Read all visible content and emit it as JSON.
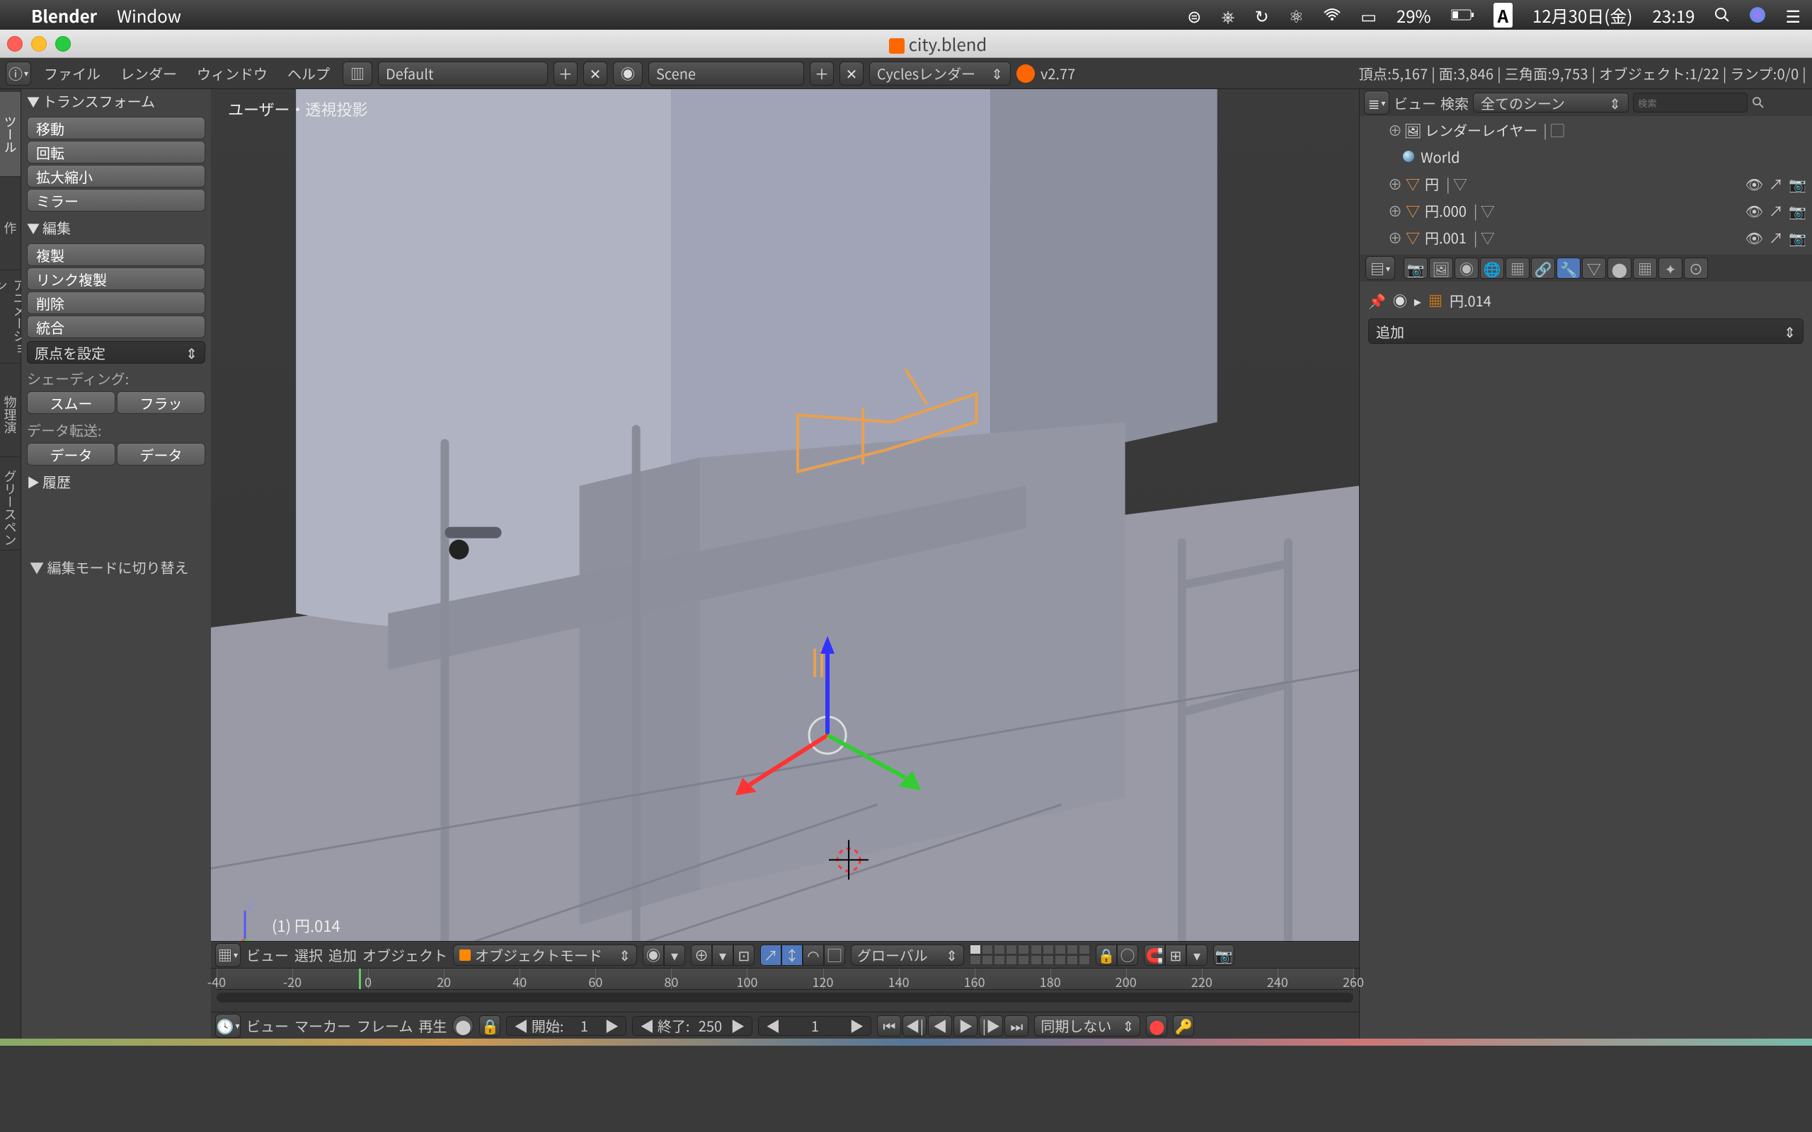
{
  "macos": {
    "app": "Blender",
    "menu_window": "Window",
    "battery": "29%",
    "input": "A",
    "date": "12月30日(金)",
    "time": "23:19"
  },
  "window": {
    "title": "city.blend"
  },
  "info": {
    "menus": {
      "file": "ファイル",
      "render": "レンダー",
      "window": "ウィンドウ",
      "help": "ヘルプ"
    },
    "layout": "Default",
    "scene": "Scene",
    "engine": "Cyclesレンダー",
    "version": "v2.77",
    "stats": "頂点:5,167 | 面:3,846 | 三角面:9,753 | オブジェクト:1/22 | ランプ:0/0 |"
  },
  "sidetabs": [
    "ツール",
    "作",
    "アニメーション",
    "物理演",
    "グリースペン"
  ],
  "toolshelf": {
    "transform_header": "トランスフォーム",
    "translate": "移動",
    "rotate": "回転",
    "scale": "拡大縮小",
    "mirror": "ミラー",
    "edit_header": "編集",
    "duplicate": "複製",
    "link_duplicate": "リンク複製",
    "delete": "削除",
    "join": "統合",
    "set_origin": "原点を設定",
    "shading_label": "シェーディング:",
    "smooth": "スムー",
    "flat": "フラッ",
    "data_transfer_label": "データ転送:",
    "data": "データ",
    "history_header": "履歴",
    "last_action": "編集モードに切り替え"
  },
  "viewport": {
    "projection": "ユーザー・透視投影",
    "active_object": "(1) 円.014"
  },
  "view_header": {
    "menus": {
      "view": "ビュー",
      "select": "選択",
      "add": "追加",
      "object": "オブジェクト"
    },
    "mode": "オブジェクトモード",
    "orientation": "グローバル"
  },
  "timeline": {
    "start_label": "開始:",
    "start": "1",
    "end_label": "終了:",
    "end": "250",
    "current": "1",
    "sync": "同期しない",
    "menus": {
      "view": "ビュー",
      "marker": "マーカー",
      "frame": "フレーム",
      "playback": "再生"
    },
    "ticks": [
      "-40",
      "-20",
      "0",
      "20",
      "40",
      "60",
      "80",
      "100",
      "120",
      "140",
      "160",
      "180",
      "200",
      "220",
      "240",
      "260"
    ]
  },
  "outliner_header": {
    "menu_view": "ビュー",
    "menu_search": "検索",
    "filter": "全てのシーン"
  },
  "outliner": {
    "render_layers": "レンダーレイヤー",
    "world": "World",
    "items": [
      "円",
      "円.000",
      "円.001"
    ]
  },
  "properties": {
    "crumb_object": "円.014",
    "add": "追加"
  }
}
